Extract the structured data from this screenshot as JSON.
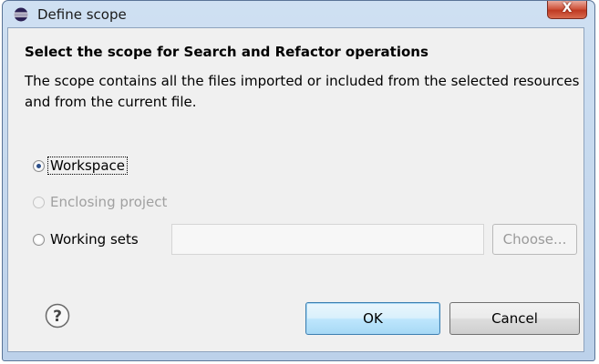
{
  "window": {
    "title": "Define scope",
    "close_label": "X"
  },
  "content": {
    "heading": "Select the scope for Search and Refactor operations",
    "description": "The scope contains all the files imported or included from the selected resources and from the current file."
  },
  "options": {
    "workspace_label": "Workspace",
    "enclosing_project_label": "Enclosing project",
    "working_sets_label": "Working sets",
    "selected": "Workspace"
  },
  "working_sets": {
    "input_value": "",
    "choose_label": "Choose..."
  },
  "buttons": {
    "ok_label": "OK",
    "cancel_label": "Cancel"
  },
  "icons": {
    "app": "eclipse-icon",
    "help": "help-icon",
    "close": "close-icon"
  }
}
